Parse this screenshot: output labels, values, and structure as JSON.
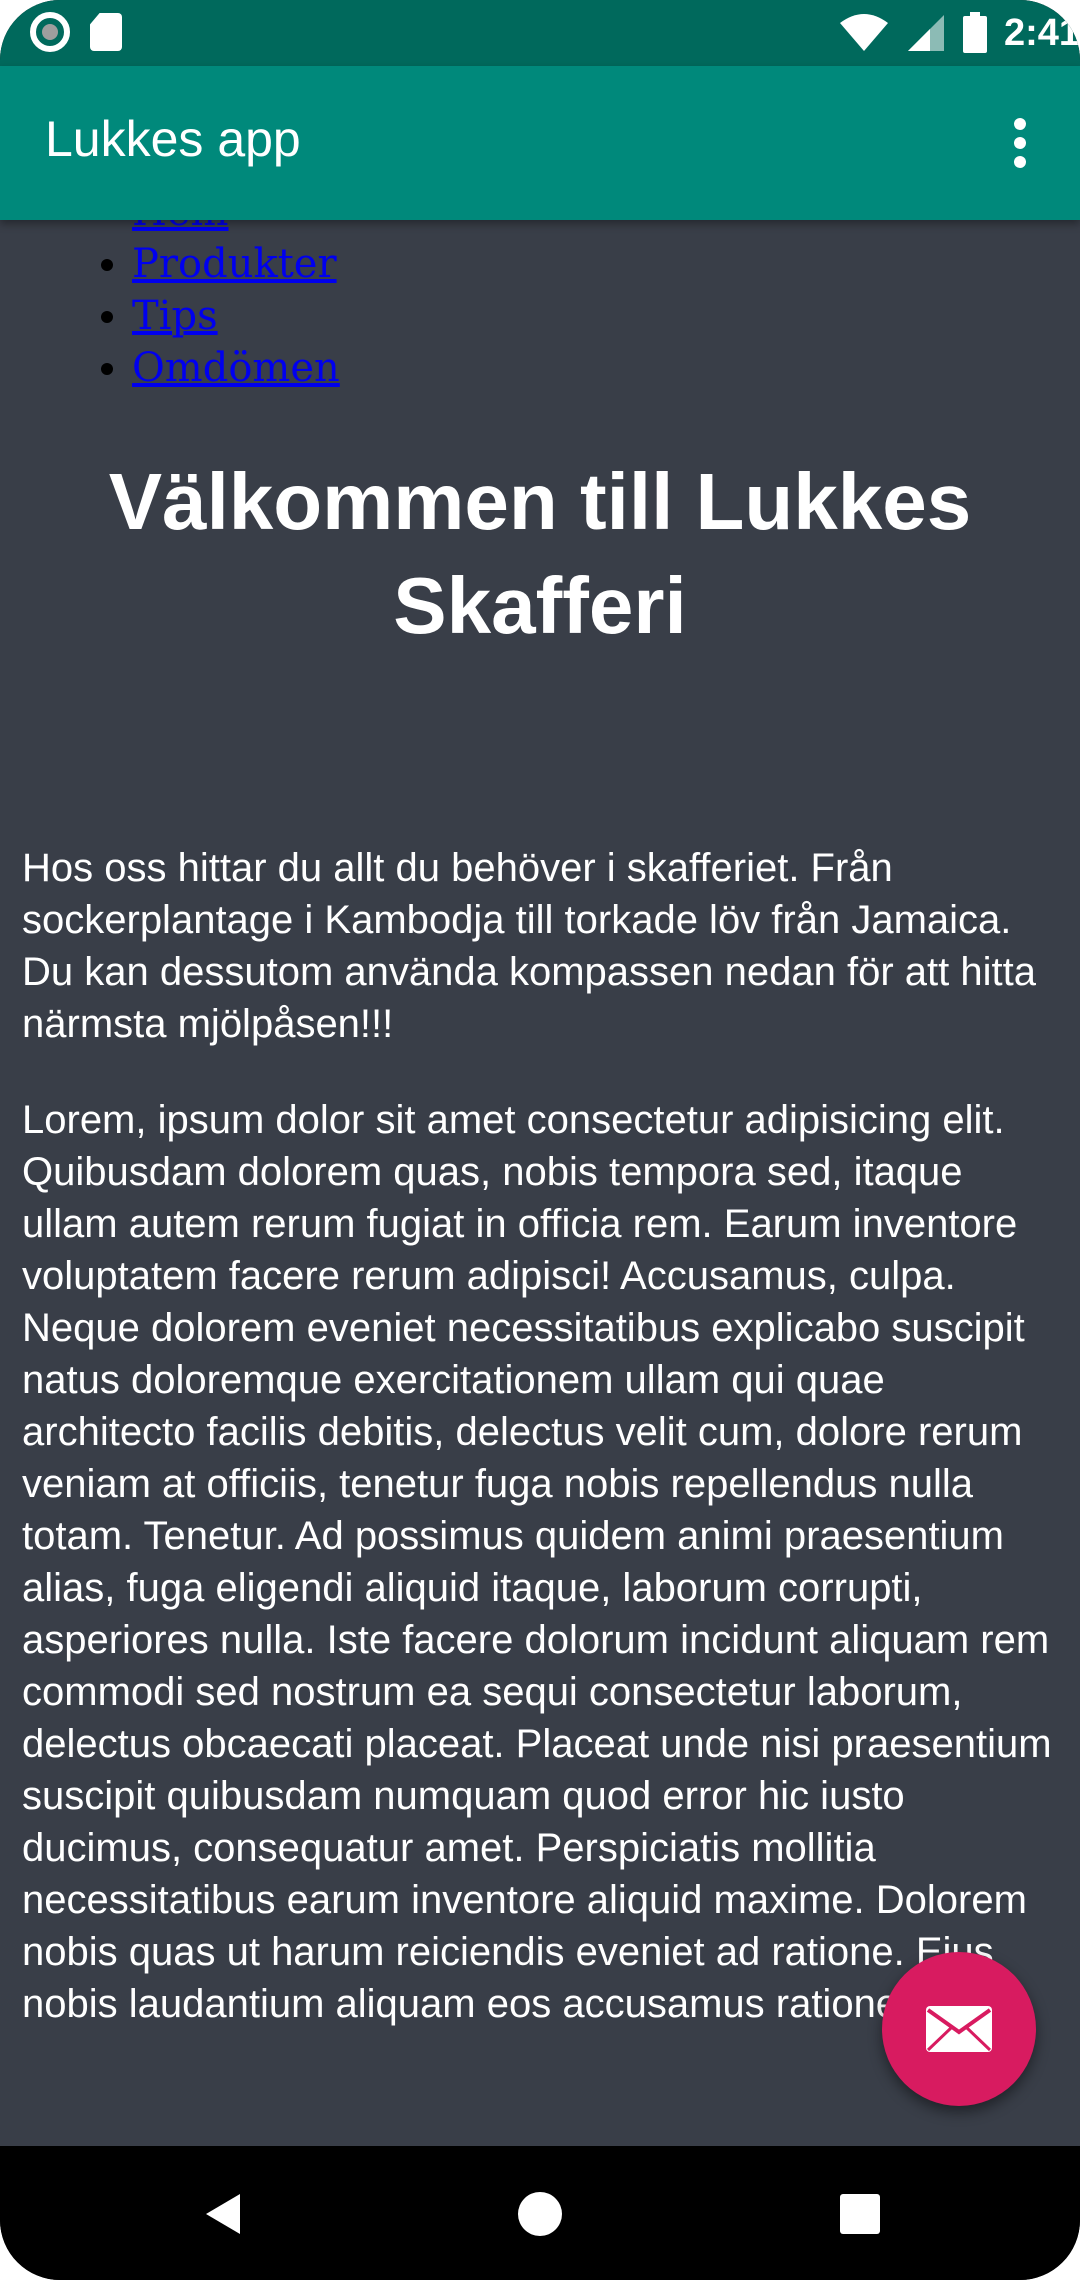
{
  "status_bar": {
    "time": "2:41",
    "icons": [
      "record-icon",
      "sd-card-icon",
      "wifi-icon",
      "signal-icon",
      "battery-icon"
    ]
  },
  "app_bar": {
    "title": "Lukkes app",
    "menu_icon": "overflow-menu-icon",
    "background": "#00897b"
  },
  "page": {
    "nav_items": [
      {
        "label": "Hem"
      },
      {
        "label": "Produkter"
      },
      {
        "label": "Tips"
      },
      {
        "label": "Omdömen"
      }
    ],
    "heading": "Välkommen till Lukkes Skafferi",
    "intro": "Hos oss hittar du allt du behöver i skafferiet. Från sockerplantage i Kambodja till torkade löv från Jamaica. Du kan dessutom använda kompassen nedan för att hitta närmsta mjölpåsen!!!",
    "body": "Lorem, ipsum dolor sit amet consectetur adipisicing elit. Quibusdam dolorem quas, nobis tempora sed, itaque ullam autem rerum fugiat in officia rem. Earum inventore voluptatem facere rerum adipisci! Accusamus, culpa. Neque dolorem eveniet necessitatibus explicabo suscipit natus doloremque exercitationem ullam qui quae architecto facilis debitis, delectus velit cum, dolore rerum veniam at officiis, tenetur fuga nobis repellendus nulla totam. Tenetur. Ad possimus quidem animi praesentium alias, fuga eligendi aliquid itaque, laborum corrupti, asperiores nulla. Iste facere dolorum incidunt aliquam rem commodi sed nostrum ea sequi consectetur laborum, delectus obcaecati placeat. Placeat unde nisi praesentium suscipit quibusdam numquam quod error hic iusto ducimus, consequatur amet. Perspiciatis mollitia necessitatibus earum inventore aliquid maxime. Dolorem nobis quas ut harum reiciendis eveniet ad ratione. Eius nobis laudantium aliquam eos accusamus ratione rerum",
    "background": "#393e48"
  },
  "fab": {
    "icon": "mail-icon",
    "color": "#d81b60"
  },
  "nav_bar": {
    "icons": [
      "back-icon",
      "home-icon",
      "recents-icon"
    ]
  }
}
